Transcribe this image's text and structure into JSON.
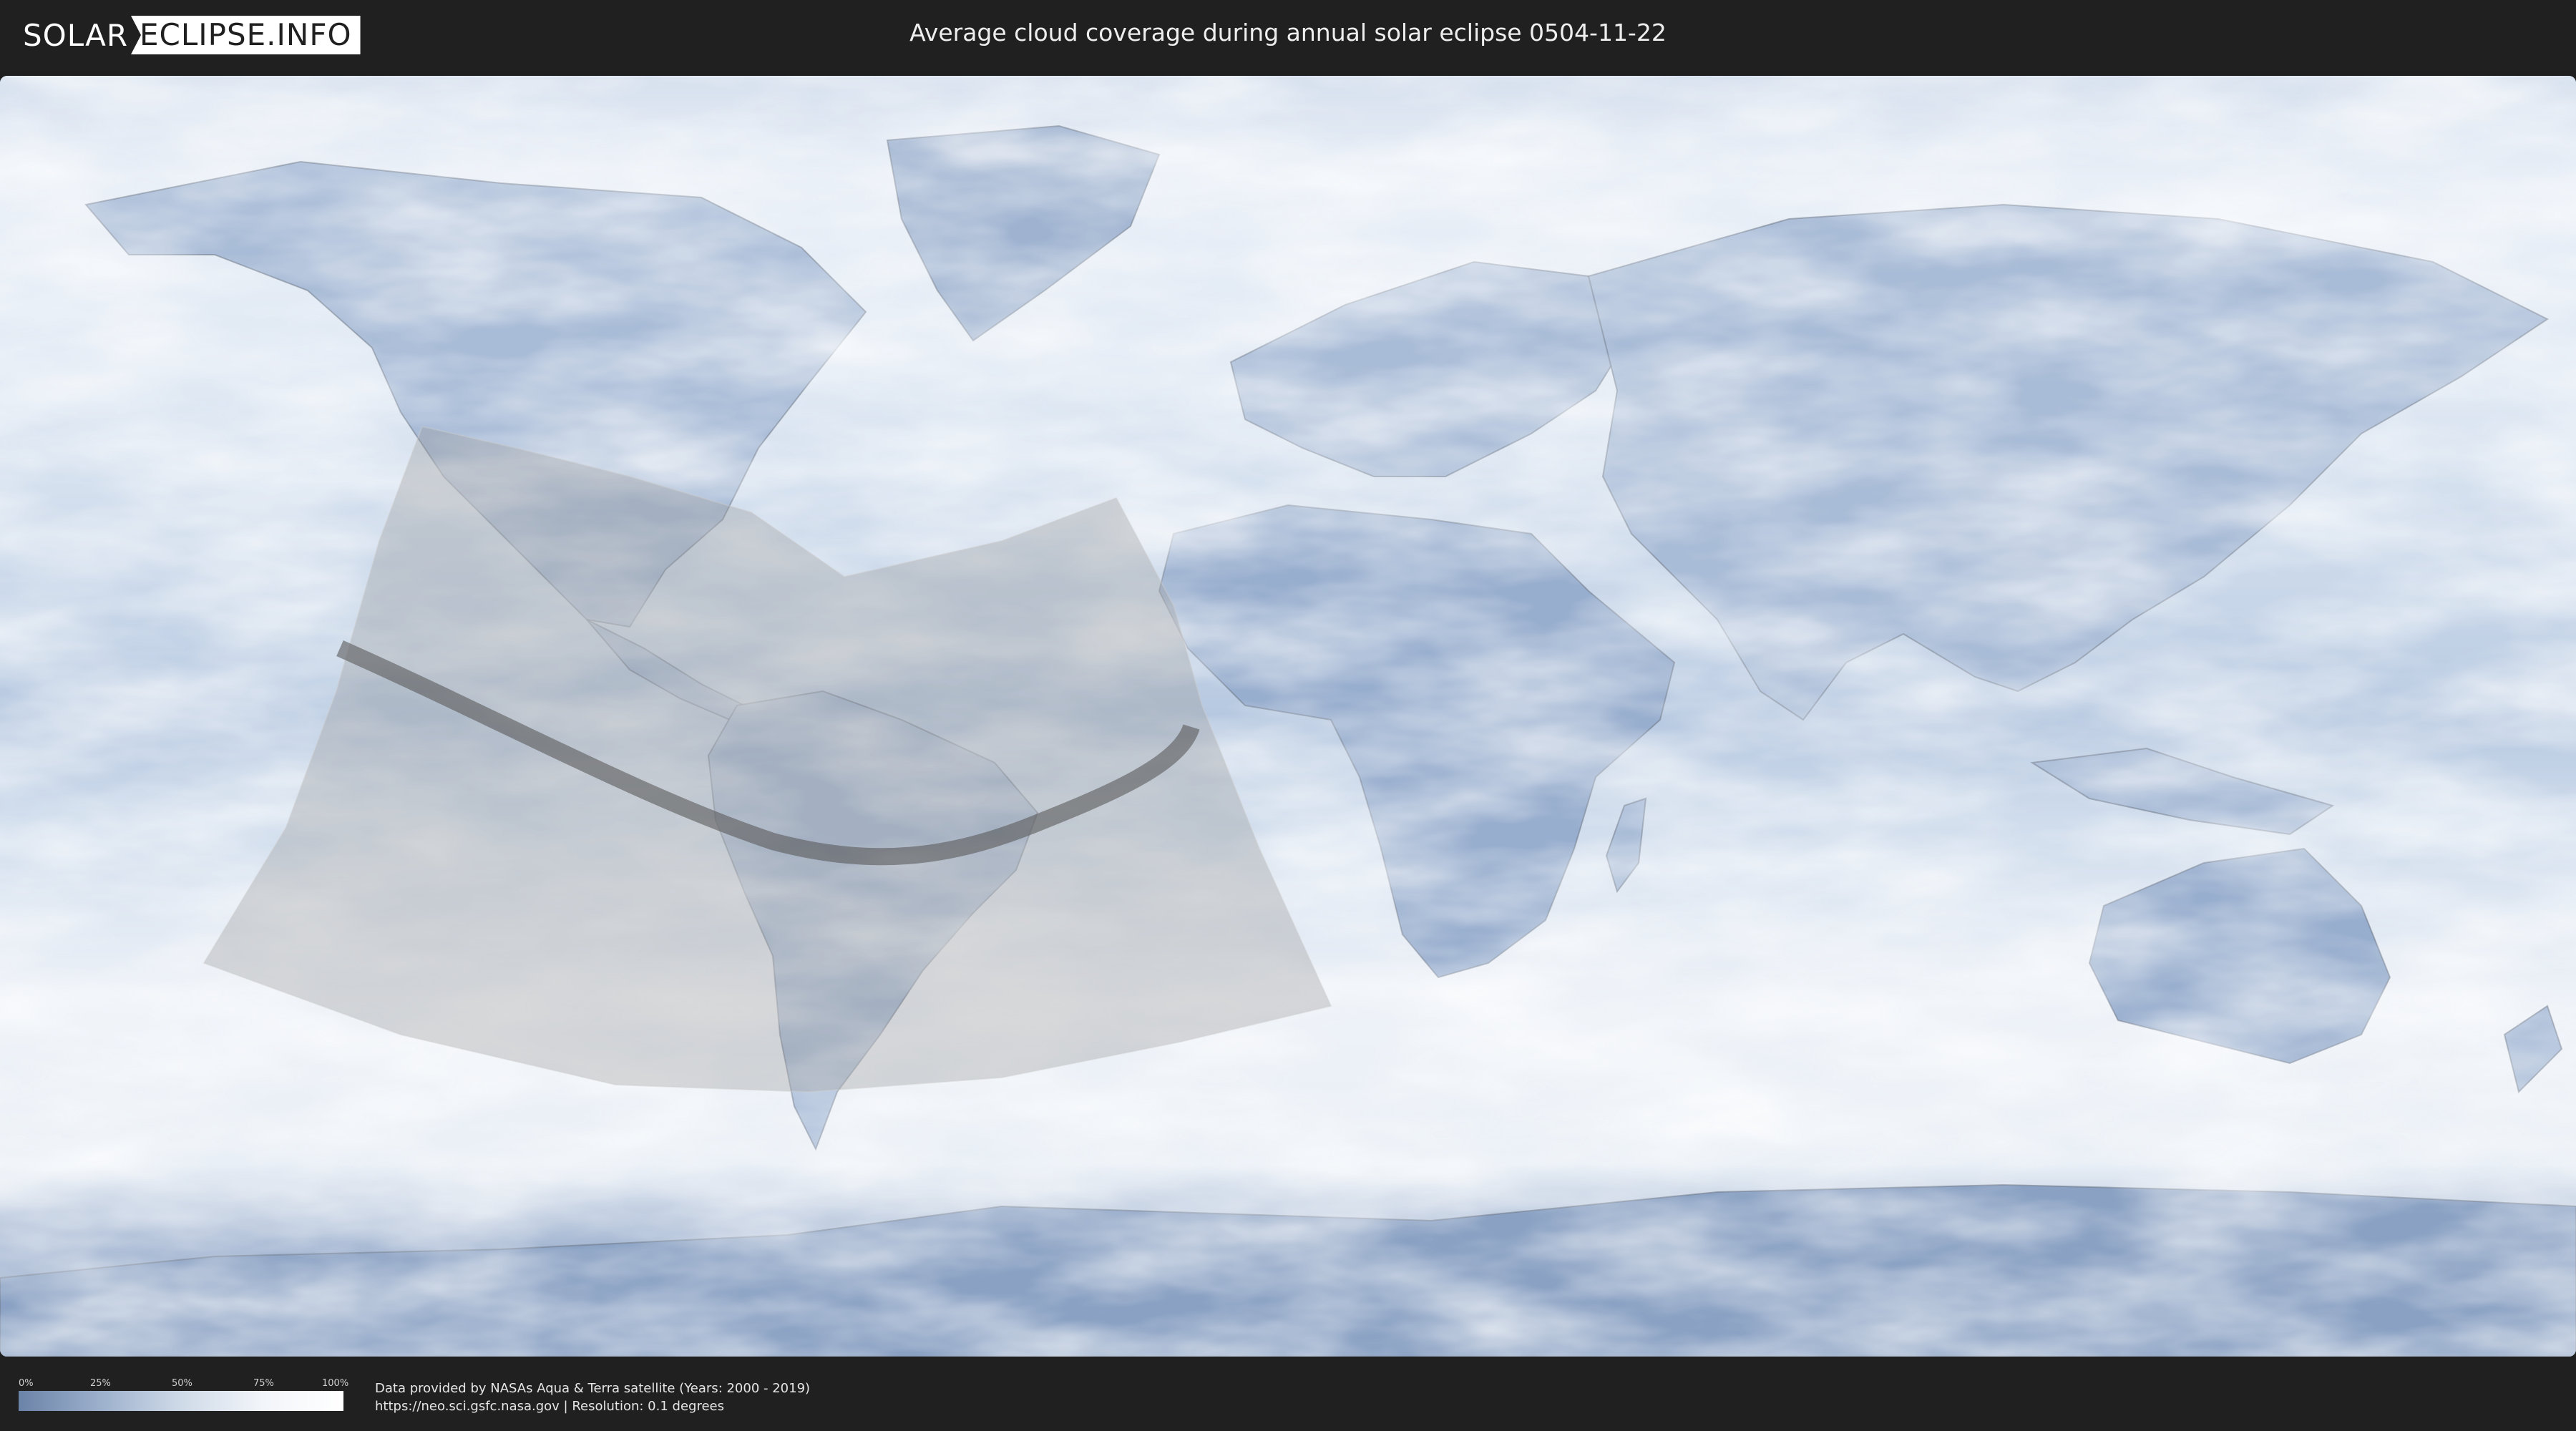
{
  "header": {
    "logo_part1": "SOLAR",
    "logo_part2": "ECLIPSE.INFO",
    "title": "Average cloud coverage during annual solar eclipse 0504-11-22"
  },
  "map": {
    "colors": {
      "clear_sky": "#6b83a8",
      "cloudy": "#ffffff",
      "land_outline": "#6d7685",
      "eclipse_zone": "#8a8a8a",
      "central_path": "#5a5a5a"
    }
  },
  "legend": {
    "ticks": [
      "0%",
      "25%",
      "50%",
      "75%",
      "100%"
    ]
  },
  "footer": {
    "credit_line1": "Data provided by NASAs Aqua & Terra satellite (Years: 2000 - 2019)",
    "credit_line2": "https://neo.sci.gsfc.nasa.gov | Resolution: 0.1 degrees"
  }
}
